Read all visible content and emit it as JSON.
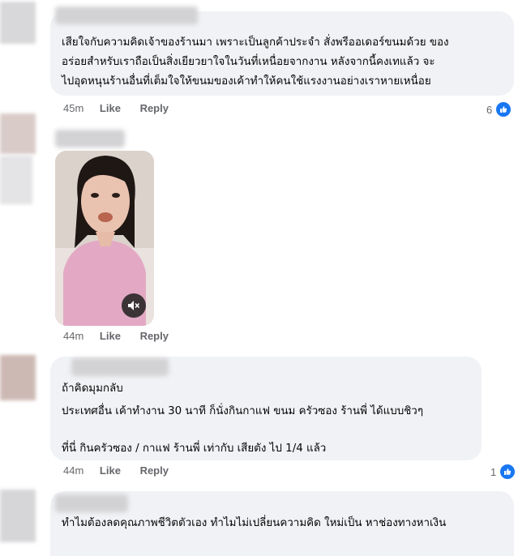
{
  "comments": [
    {
      "lines": [
        "เสียใจกับความคิดเจ้าของร้านมา เพราะเป็นลูกค้าประจำ สั่งพรีออเดอร์ขนมด้วย ของ",
        "อร่อยสำหรับเราถือเป็นสิ่งเยียวยาใจในวันที่เหนื่อยจากงาน หลังจากนี้คงเทแล้ว จะ",
        "ไปอุดหนุนร้านอื่นที่เต็มใจให้ขนมของเค้าทำให้คนใช้แรงงานอย่างเราหายเหนื่อย"
      ],
      "time": "45m",
      "like": "Like",
      "reply": "Reply",
      "reactions": "6"
    },
    {
      "time": "44m",
      "like": "Like",
      "reply": "Reply",
      "video_label": "Muted video"
    },
    {
      "lines": [
        "ถ้าคิดมุมกลับ",
        "ประเทศอื่น เค้าทำงาน 30 นาที ก็นั่งกินกาแฟ ขนม ครัวซอง ร้านพี่ ได้แบบชิวๆ",
        "",
        "ที่นี่ กินครัวซอง / กาแฟ ร้านพี่ เท่ากับ เสียตัง ไป 1/4 แล้ว"
      ],
      "time": "44m",
      "like": "Like",
      "reply": "Reply",
      "reactions": "1"
    },
    {
      "lines": [
        "ทำไมต้องลดคุณภาพชีวิตตัวเอง ทำไมไม่เปลี่ยนความคิด ใหม่เป็น หาช่องทางหาเงิน"
      ]
    }
  ],
  "colors": {
    "bubble": "#f0f2f5",
    "meta": "#65676b",
    "like_badge": "#1877f2"
  }
}
